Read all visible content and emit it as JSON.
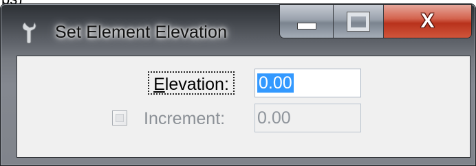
{
  "background": {
    "scrap_text": "ps)"
  },
  "window": {
    "title": "Set Element Elevation",
    "icon": "wrench-icon",
    "buttons": {
      "minimize_icon": "minimize-icon",
      "maximize_icon": "maximize-icon",
      "close_label": "X"
    }
  },
  "form": {
    "elevation": {
      "label_prefix": "E",
      "label_rest": "levation:",
      "value": "0.00",
      "selected": true
    },
    "increment": {
      "checked": false,
      "enabled": false,
      "label": "Increment:",
      "value": "0.00"
    }
  },
  "colors": {
    "selection": "#3399ff",
    "close_button": "#c8432b",
    "disabled_text": "#8b9096"
  }
}
